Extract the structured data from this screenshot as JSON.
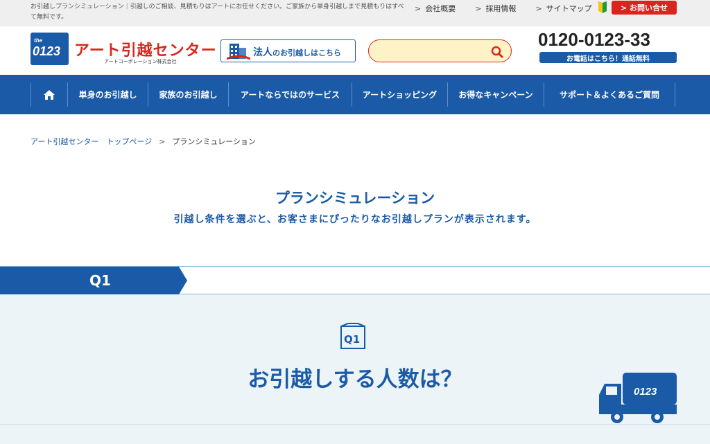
{
  "topbar": {
    "description": "お引越しプランシミュレーション｜引越しのご相談、見積もりはアートにお任せください。ご家族から単身引越しまで見積もりはすべて無料です。",
    "links": [
      {
        "chev": ">",
        "label": "会社概要"
      },
      {
        "chev": ">",
        "label": "採用情報"
      },
      {
        "chev": ">",
        "label": "サイトマップ"
      }
    ],
    "inquiry_label": "> お問い合せ"
  },
  "header": {
    "logo_badge": "0123",
    "logo_badge_small": "the",
    "logo_text": "アート引越センター",
    "logo_sub": "アートコーポレーション株式会社",
    "corporate_label_big": "法人",
    "corporate_label_small": "のお引越しはこちら",
    "search_placeholder": "",
    "tel": "0120-0123-33",
    "tel_note": "お電話はこちら！通話無料"
  },
  "nav": {
    "items": [
      {
        "label": "",
        "icon": "home-icon"
      },
      {
        "label": "単身のお引越し"
      },
      {
        "label": "家族のお引越し"
      },
      {
        "label": "アートならではのサービス"
      },
      {
        "label": "アートショッピング"
      },
      {
        "label": "お得なキャンペーン"
      },
      {
        "label": "サポート＆よくあるご質問"
      }
    ]
  },
  "breadcrumb": {
    "home": "アート引越センター　トップページ",
    "sep": ">",
    "current": "プランシミュレーション"
  },
  "page": {
    "title": "プランシミュレーション",
    "subtitle": "引越し条件を選ぶと、お客さまにぴったりなお引越しプランが表示されます。"
  },
  "question": {
    "tab_label": "Q1",
    "icon_label": "Q1",
    "text": "お引越しする人数は？",
    "truck_label": "0123"
  },
  "colors": {
    "brand_blue": "#1a5aa7",
    "brand_red": "#d9251d",
    "panel_bg": "#edf4f7"
  }
}
